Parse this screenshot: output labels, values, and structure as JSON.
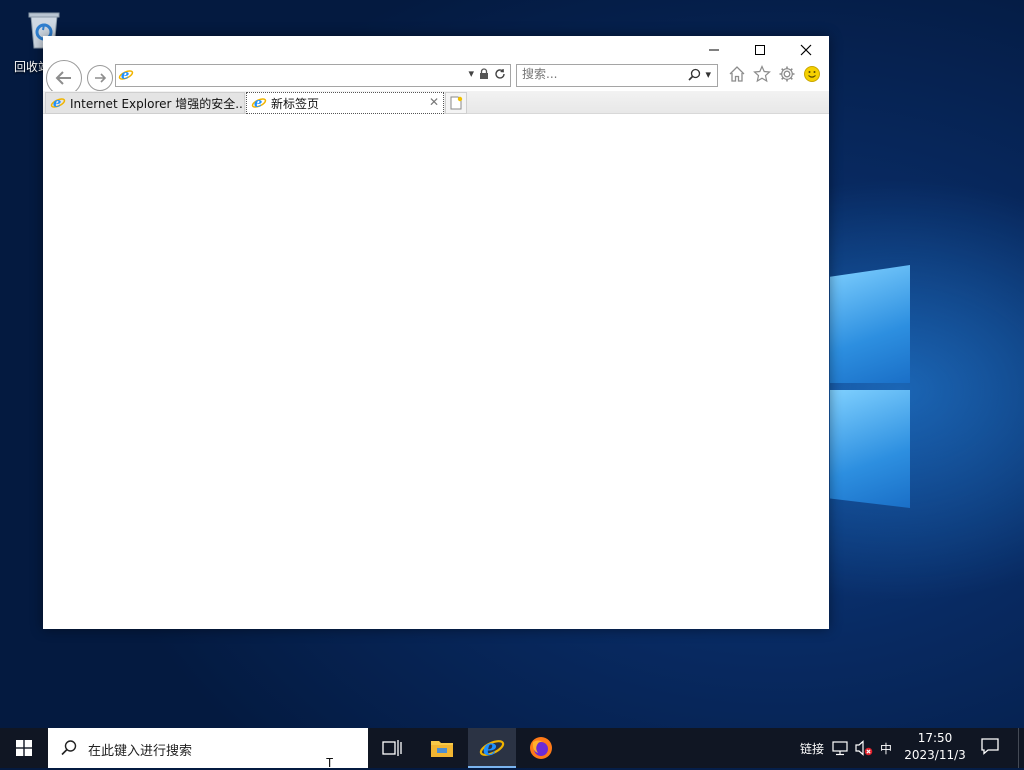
{
  "desktop": {
    "recycle_bin_label": "回收站"
  },
  "window": {
    "controls": {
      "minimize": "—",
      "maximize": "☐",
      "close": "✕"
    },
    "address": {
      "value": "",
      "placeholder": ""
    },
    "search": {
      "placeholder": "搜索..."
    },
    "tabs": [
      {
        "label": "Internet Explorer 增强的安全...",
        "active": false
      },
      {
        "label": "新标签页",
        "active": true
      }
    ],
    "tab_close_glyph": "✕"
  },
  "taskbar": {
    "search_placeholder": "在此键入进行搜索",
    "cursor_glyph": "T",
    "tray": {
      "links_label": "链接",
      "ime_label": "中"
    },
    "clock": {
      "time": "17:50",
      "date": "2023/11/3"
    }
  },
  "colors": {
    "taskbar": "#101623",
    "ie_blue": "#1e90ff",
    "ie_ring": "#f0b400",
    "smiley": "#f5d000"
  }
}
